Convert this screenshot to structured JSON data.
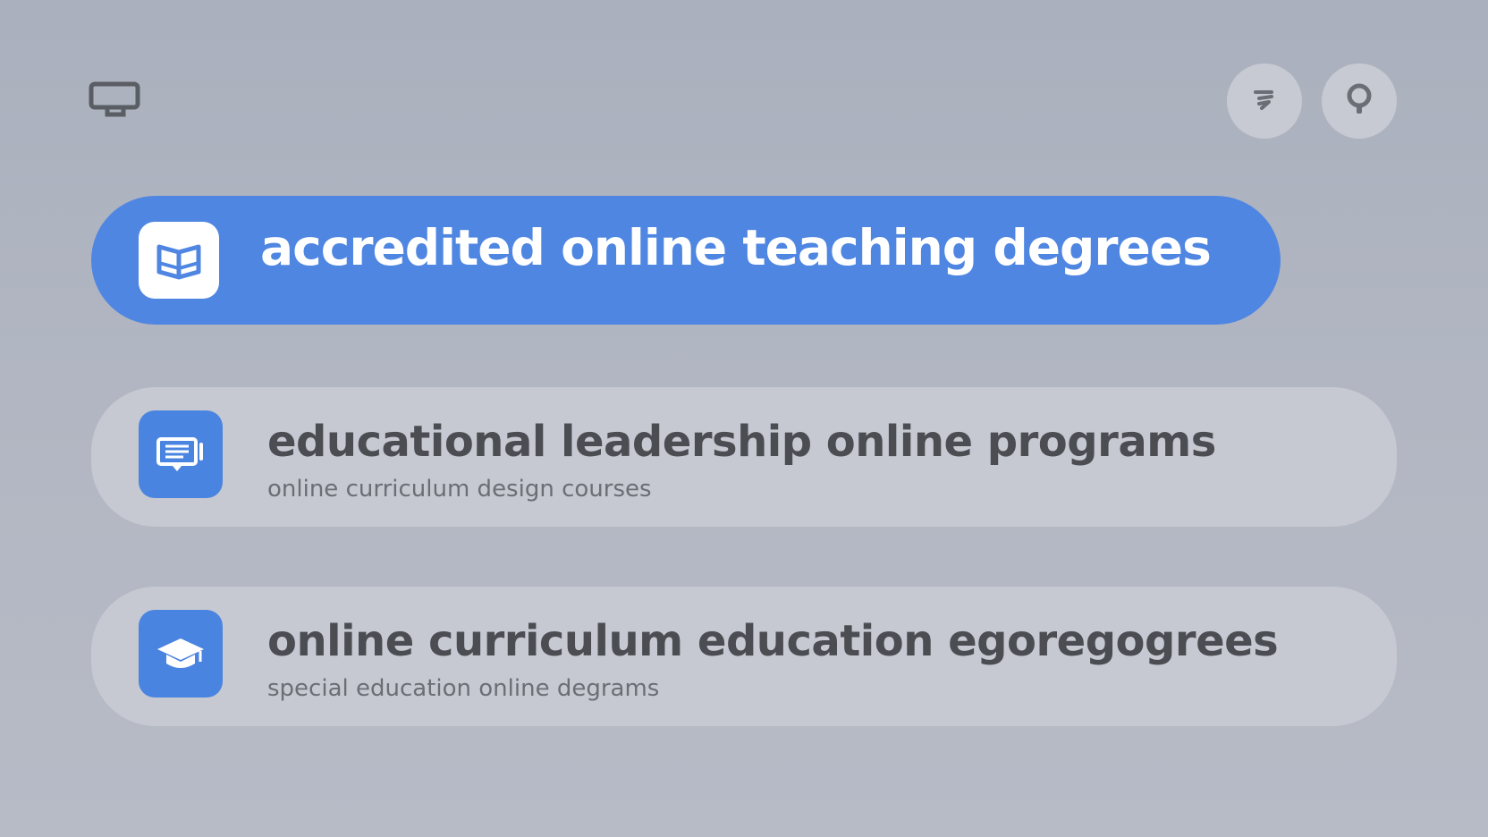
{
  "header": {
    "tv_icon": "tv-icon",
    "voice_button_icon": "voice-icon",
    "search_button_icon": "search-icon"
  },
  "suggestions": [
    {
      "title": "accredited online teaching degrees",
      "subtitle": "",
      "icon": "open-book-icon",
      "selected": true
    },
    {
      "title": "educational leadership online programs",
      "subtitle": "online curriculum design courses",
      "icon": "presentation-board-icon",
      "selected": false
    },
    {
      "title": "online curriculum education egoregogrees",
      "subtitle": "special education online degrams",
      "icon": "graduation-cap-icon",
      "selected": false
    }
  ],
  "colors": {
    "background": "#b1b6c2",
    "accent": "#4f86e2",
    "card": "#c6c9d1",
    "title_text": "#4b4d53",
    "subtitle_text": "#6b6e75"
  }
}
